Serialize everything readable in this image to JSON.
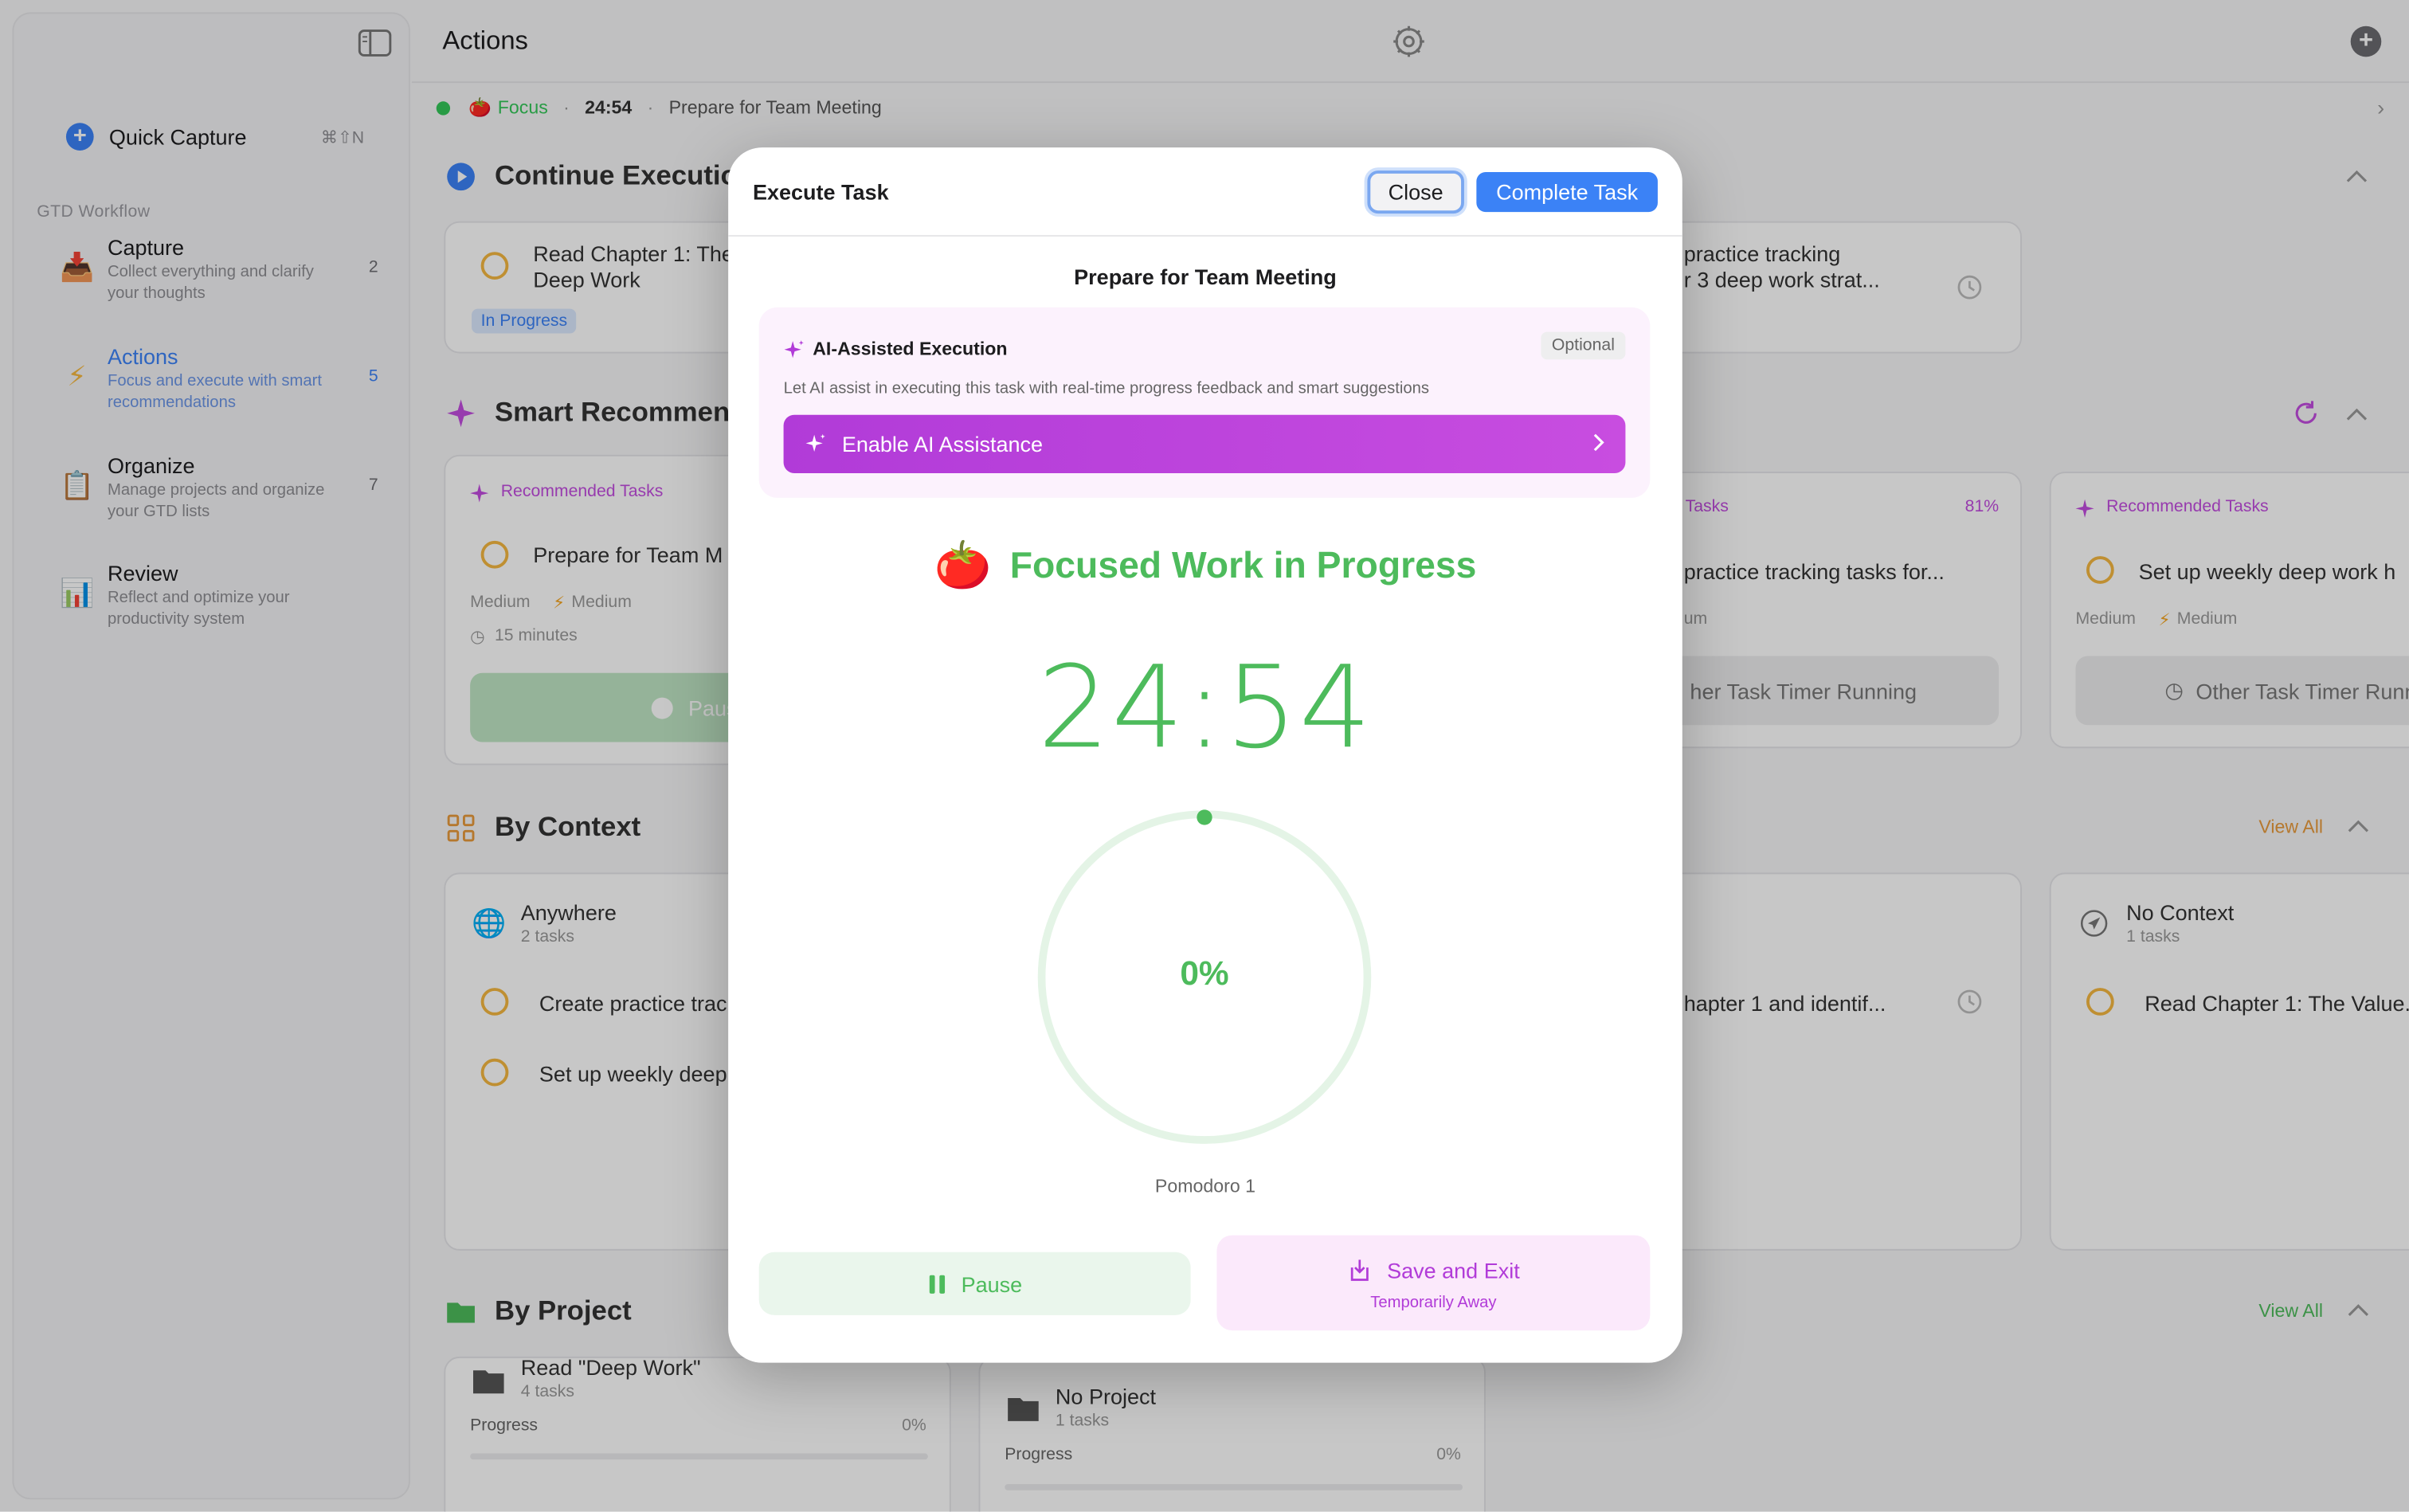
{
  "sidebar": {
    "quick_capture": {
      "label": "Quick Capture",
      "shortcut": "⌘⇧N"
    },
    "section_title": "GTD Workflow",
    "items": [
      {
        "title": "Capture",
        "desc": "Collect everything and clarify your thoughts",
        "count": "2",
        "icon": "inbox-icon"
      },
      {
        "title": "Actions",
        "desc": "Focus and execute with smart recommendations",
        "count": "5",
        "icon": "lightning-icon",
        "active": true
      },
      {
        "title": "Organize",
        "desc": "Manage projects and organize your GTD lists",
        "count": "7",
        "icon": "clipboard-icon"
      },
      {
        "title": "Review",
        "desc": "Reflect and optimize your productivity system",
        "icon": "bar-chart-icon"
      }
    ]
  },
  "header": {
    "title": "Actions"
  },
  "focus_bar": {
    "mode": "Focus",
    "time": "24:54",
    "task": "Prepare for Team Meeting",
    "sep": "·"
  },
  "main": {
    "continue": {
      "title": "Continue Execution",
      "card1": {
        "text_line1": "Read Chapter 1: The",
        "text_line2": "Deep Work",
        "badge": "In Progress"
      },
      "card2": {
        "text_line1": "practice tracking",
        "text_line2": "r 3 deep work strat..."
      }
    },
    "smart": {
      "title": "Smart Recommen",
      "card1": {
        "label": "Recommended Tasks",
        "task": "Prepare for Team M",
        "priority": "Medium",
        "energy": "Medium",
        "duration": "15 minutes",
        "button": "Paus"
      },
      "card2": {
        "label": "Tasks",
        "percent": "81%",
        "task": "practice tracking tasks for...",
        "meta": "um",
        "button": "her Task Timer Running"
      },
      "card3": {
        "label": "Recommended Tasks",
        "task": "Set up weekly deep work h",
        "priority": "Medium",
        "energy": "Medium",
        "button": "Other Task Timer Runn"
      }
    },
    "context": {
      "title": "By Context",
      "view_all": "View All",
      "card1": {
        "name": "Anywhere",
        "count": "2 tasks",
        "task1": "Create practice trac",
        "task2": "Set up weekly deep"
      },
      "card2": {
        "task": "hapter 1 and identif..."
      },
      "card3": {
        "name": "No Context",
        "count": "1 tasks",
        "task": "Read Chapter 1: The Value..."
      }
    },
    "project": {
      "title": "By Project",
      "view_all": "View All",
      "card1": {
        "name": "Read \"Deep Work\"",
        "count": "4 tasks",
        "progress_label": "Progress",
        "progress_value": "0%",
        "progress": 0
      },
      "card2": {
        "name": "No Project",
        "count": "1 tasks",
        "progress_label": "Progress",
        "progress_value": "0%",
        "progress": 0
      }
    }
  },
  "modal": {
    "title": "Execute Task",
    "close": "Close",
    "complete": "Complete Task",
    "task_name": "Prepare for Team Meeting",
    "ai": {
      "title": "AI-Assisted Execution",
      "optional": "Optional",
      "desc": "Let AI assist in executing this task with real-time progress feedback and smart suggestions",
      "button": "Enable AI Assistance"
    },
    "status": "Focused Work in Progress",
    "timer": "24:54",
    "progress_pct": "0%",
    "progress": 0,
    "pomodoro": "Pomodoro 1",
    "pause": "Pause",
    "save": "Save and Exit",
    "save_sub": "Temporarily Away"
  },
  "colors": {
    "accent": "#3b82f6",
    "green": "#4dbb5c",
    "purple": "#b13bd8",
    "orange": "#f5b840"
  }
}
